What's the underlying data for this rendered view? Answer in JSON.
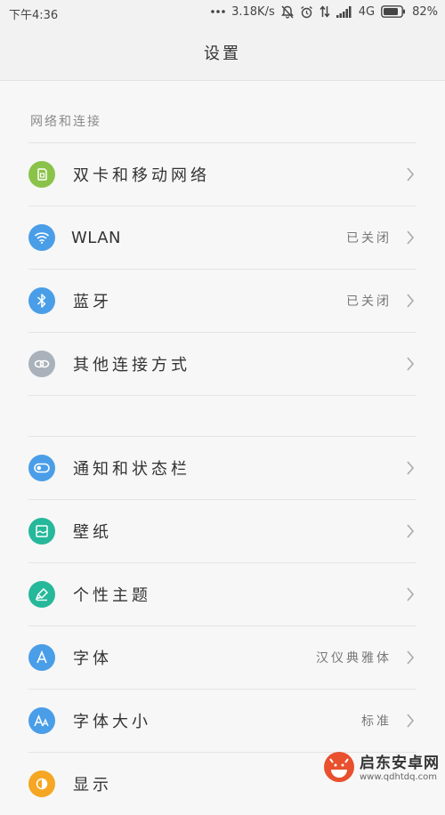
{
  "status_bar": {
    "time": "下午4:36",
    "speed": "3.18K/s",
    "network": "4G",
    "battery": "82%"
  },
  "header": {
    "title": "设置"
  },
  "sections": {
    "network_header": "网络和连接"
  },
  "rows": {
    "dual_sim": {
      "label": "双卡和移动网络",
      "icon": "sim-card-icon",
      "color": "#8bc34a"
    },
    "wlan": {
      "label": "WLAN",
      "value": "已关闭",
      "icon": "wifi-icon",
      "color": "#4a9ee8"
    },
    "bluetooth": {
      "label": "蓝牙",
      "value": "已关闭",
      "icon": "bluetooth-icon",
      "color": "#4a9ee8"
    },
    "other_connections": {
      "label": "其他连接方式",
      "icon": "link-icon",
      "color": "#a9b1ba"
    },
    "notifications": {
      "label": "通知和状态栏",
      "icon": "toggle-icon",
      "color": "#4a9ee8"
    },
    "wallpaper": {
      "label": "壁纸",
      "icon": "wallpaper-icon",
      "color": "#26b89a"
    },
    "themes": {
      "label": "个性主题",
      "icon": "brush-icon",
      "color": "#26b89a"
    },
    "font": {
      "label": "字体",
      "value": "汉仪典雅体",
      "icon": "font-a-icon",
      "color": "#4a9ee8"
    },
    "font_size": {
      "label": "字体大小",
      "value": "标准",
      "icon": "font-size-icon",
      "color": "#4a9ee8"
    },
    "display": {
      "label": "显示",
      "icon": "display-icon",
      "color": "#f5a623"
    }
  },
  "watermark": {
    "name": "启东安卓网",
    "url": "www.qdhtdq.com",
    "accent": "#e8502e"
  }
}
